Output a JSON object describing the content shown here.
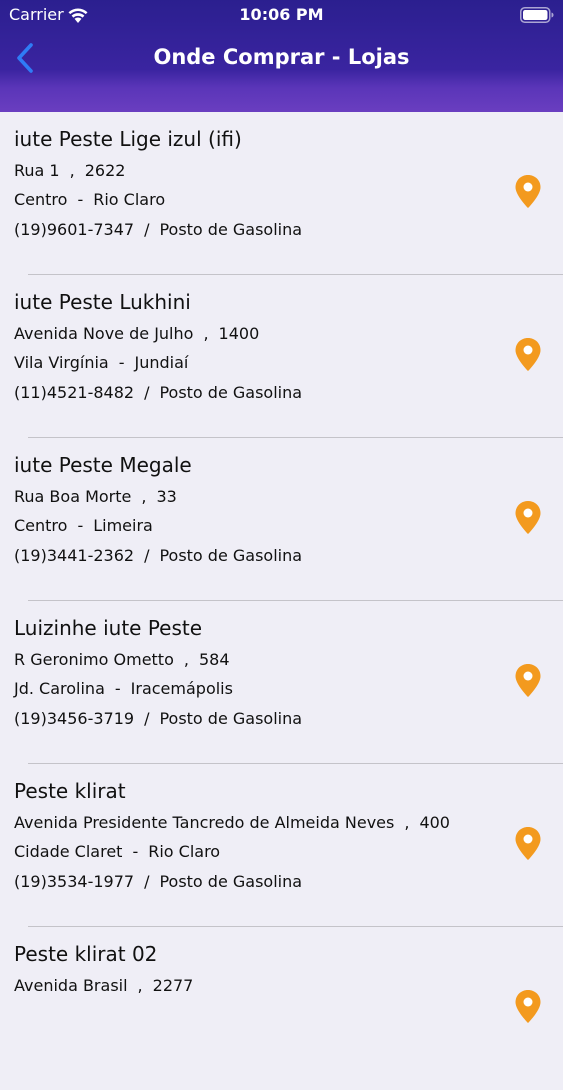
{
  "status_bar": {
    "carrier": "Carrier",
    "time": "10:06 PM"
  },
  "nav": {
    "title": "Onde Comprar - Lojas",
    "back_icon": "chevron-left-icon"
  },
  "colors": {
    "header_top": "#2b1f8f",
    "header_bottom": "#6a3ec0",
    "back_accent": "#2f7cf6",
    "pin": "#f39a1e",
    "list_bg": "#efeef6"
  },
  "stores": [
    {
      "name": "iute Peste Lige izul (ifi)",
      "street": "Rua 1",
      "number": "2622",
      "district": "Centro",
      "city": "Rio Claro",
      "phone": "(19)9601-7347",
      "type": "Posto de Gasolina"
    },
    {
      "name": "iute Peste Lukhini",
      "street": "Avenida Nove de Julho",
      "number": "1400",
      "district": "Vila Virgínia",
      "city": "Jundiaí",
      "phone": "(11)4521-8482",
      "type": "Posto de Gasolina"
    },
    {
      "name": "iute Peste Megale",
      "street": "Rua Boa Morte",
      "number": "33",
      "district": "Centro",
      "city": "Limeira",
      "phone": "(19)3441-2362",
      "type": "Posto de Gasolina"
    },
    {
      "name": "Luizinhe iute Peste",
      "street": "R Geronimo Ometto",
      "number": "584",
      "district": "Jd. Carolina",
      "city": "Iracemápolis",
      "phone": "(19)3456-3719",
      "type": "Posto de Gasolina"
    },
    {
      "name": "Peste klirat",
      "street": "Avenida Presidente Tancredo de Almeida Neves",
      "number": "400",
      "district": "Cidade Claret",
      "city": "Rio Claro",
      "phone": "(19)3534-1977",
      "type": "Posto de Gasolina"
    },
    {
      "name": "Peste klirat 02",
      "street": "Avenida Brasil",
      "number": "2277",
      "district": "",
      "city": "",
      "phone": "",
      "type": ""
    }
  ]
}
